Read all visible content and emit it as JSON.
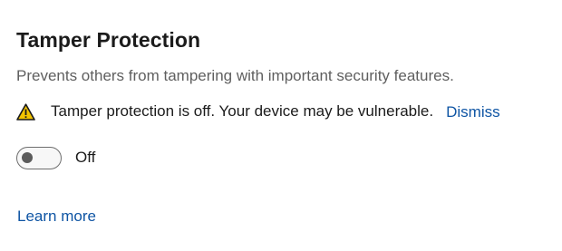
{
  "section": {
    "title": "Tamper Protection",
    "description": "Prevents others from tampering with important security features."
  },
  "warning": {
    "icon": "warning-triangle-icon",
    "message": "Tamper protection is off. Your device may be vulnerable.",
    "dismiss_label": "Dismiss"
  },
  "toggle": {
    "state": "off",
    "label": "Off"
  },
  "links": {
    "learn_more": "Learn more"
  },
  "colors": {
    "link": "#0f55a4",
    "warning_fill": "#f3c300",
    "text": "#1b1b1b",
    "secondary_text": "#5f5f5f"
  }
}
